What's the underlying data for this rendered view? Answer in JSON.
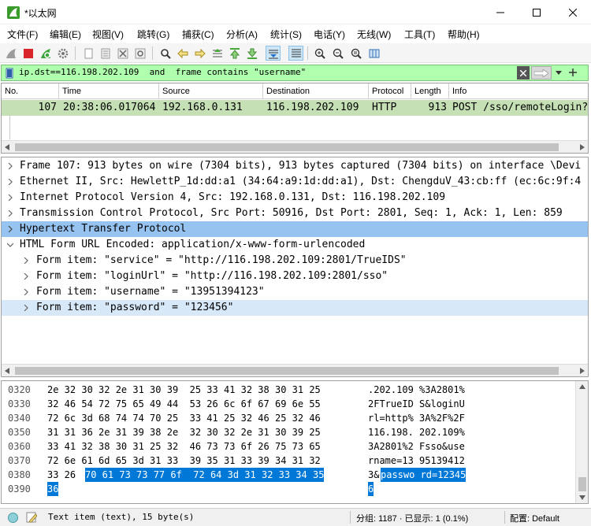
{
  "window": {
    "title": "*以太网"
  },
  "menu": [
    "文件(F)",
    "编辑(E)",
    "视图(V)",
    "跳转(G)",
    "捕获(C)",
    "分析(A)",
    "统计(S)",
    "电话(Y)",
    "无线(W)",
    "工具(T)",
    "帮助(H)"
  ],
  "filter": {
    "text": "ip.dst==116.198.202.109  and  frame contains \"username\""
  },
  "packet_list": {
    "columns": [
      "No.",
      "Time",
      "Source",
      "Destination",
      "Protocol",
      "Length",
      "Info"
    ],
    "rows": [
      {
        "no": "107",
        "time": "20:38:06.017064",
        "source": "192.168.0.131",
        "destination": "116.198.202.109",
        "protocol": "HTTP",
        "length": "913",
        "info": "POST /sso/remoteLogin?"
      }
    ]
  },
  "details": {
    "lines": [
      "Frame 107: 913 bytes on wire (7304 bits), 913 bytes captured (7304 bits) on interface \\Devi",
      "Ethernet II, Src: HewlettP_1d:dd:a1 (34:64:a9:1d:dd:a1), Dst: ChengduV_43:cb:ff (ec:6c:9f:4",
      "Internet Protocol Version 4, Src: 192.168.0.131, Dst: 116.198.202.109",
      "Transmission Control Protocol, Src Port: 50916, Dst Port: 2801, Seq: 1, Ack: 1, Len: 859",
      "Hypertext Transfer Protocol",
      "HTML Form URL Encoded: application/x-www-form-urlencoded",
      "Form item: \"service\" = \"http://116.198.202.109:2801/TrueIDS\"",
      "Form item: \"loginUrl\" = \"http://116.198.202.109:2801/sso\"",
      "Form item: \"username\" = \"13951394123\"",
      "Form item: \"password\" = \"123456\""
    ]
  },
  "bytes": {
    "rows": [
      {
        "off": "0320",
        "hex": "2e 32 30 32 2e 31 30 39  25 33 41 32 38 30 31 25",
        "ascii": ".202.109 %3A2801%"
      },
      {
        "off": "0330",
        "hex": "32 46 54 72 75 65 49 44  53 26 6c 6f 67 69 6e 55",
        "ascii": "2FTrueID S&loginU"
      },
      {
        "off": "0340",
        "hex": "72 6c 3d 68 74 74 70 25  33 41 25 32 46 25 32 46",
        "ascii": "rl=http% 3A%2F%2F"
      },
      {
        "off": "0350",
        "hex": "31 31 36 2e 31 39 38 2e  32 30 32 2e 31 30 39 25",
        "ascii": "116.198. 202.109%"
      },
      {
        "off": "0360",
        "hex": "33 41 32 38 30 31 25 32  46 73 73 6f 26 75 73 65",
        "ascii": "3A2801%2 Fsso&use"
      },
      {
        "off": "0370",
        "hex": "72 6e 61 6d 65 3d 31 33  39 35 31 33 39 34 31 32",
        "ascii": "rname=13 95139412"
      },
      {
        "off": "0380",
        "hex_plain": "33 26 ",
        "hex_sel": "70 61 73 73 77 6f  72 64 3d 31 32 33 34 35",
        "ascii_plain": "3&",
        "ascii_sel": "passwo rd=12345"
      },
      {
        "off": "0390",
        "hex_sel": "36",
        "ascii_sel": "6"
      }
    ]
  },
  "status": {
    "field": "Text item (text), 15 byte(s)",
    "packets": "分组: 1187 · 已显示: 1 (0.1%)",
    "profile": "配置: Default"
  }
}
